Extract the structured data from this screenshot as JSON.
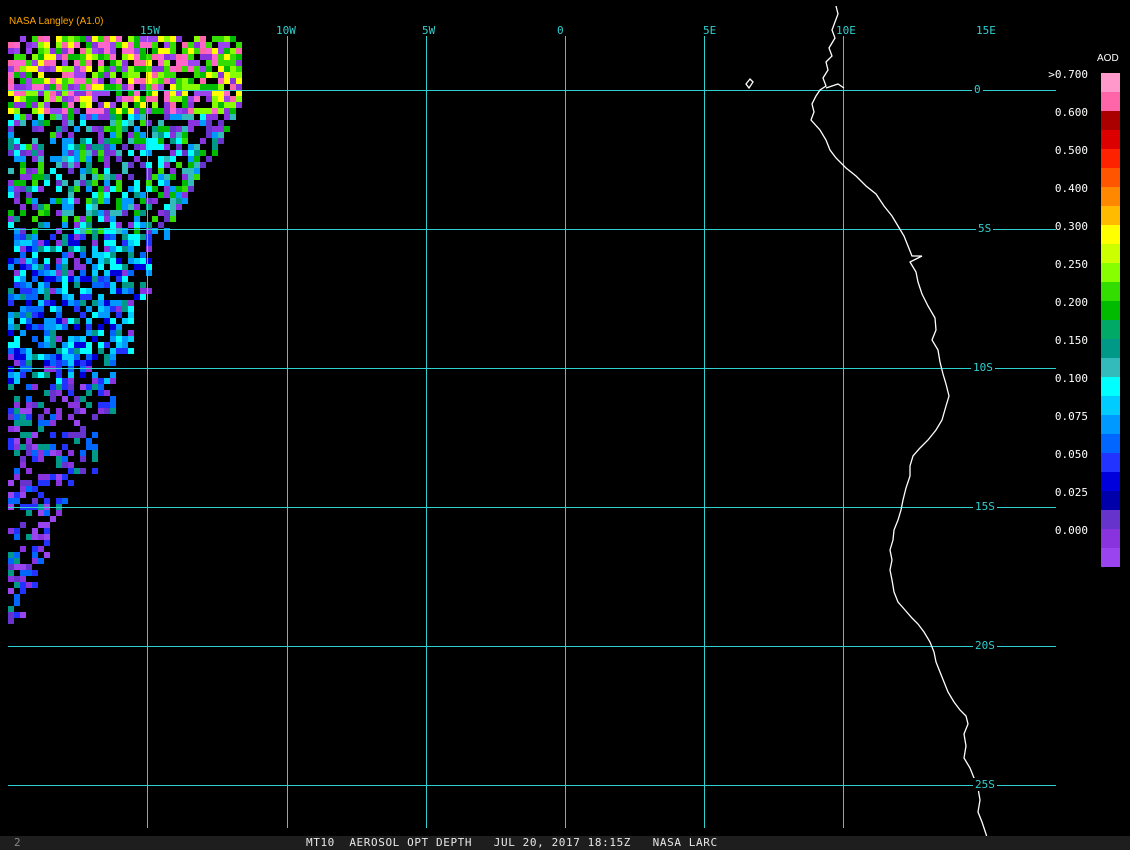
{
  "credit": "NASA Langley (A1.0)",
  "footer": {
    "text": "MT10  AEROSOL OPT DEPTH   JUL 20, 2017 18:15Z   NASA LARC",
    "page_number": "2"
  },
  "map": {
    "lon_labels": [
      "15W",
      "10W",
      "5W",
      "0",
      "5E",
      "10E",
      "15E"
    ],
    "lat_labels": [
      "0",
      "5S",
      "10S",
      "15S",
      "20S",
      "25S"
    ],
    "grid_color": "#30d0d0",
    "coastline_color": "#ffffff"
  },
  "colorbar": {
    "title": "AOD",
    "tick_labels": [
      ">0.700",
      "0.600",
      "0.500",
      "0.400",
      "0.300",
      "0.250",
      "0.200",
      "0.150",
      "0.100",
      "0.075",
      "0.050",
      "0.025",
      "0.000"
    ],
    "colors": [
      "#ff99cc",
      "#ff66aa",
      "#aa0000",
      "#dd0000",
      "#ff2200",
      "#ff5500",
      "#ff8800",
      "#ffbb00",
      "#ffff00",
      "#ccff00",
      "#88ff00",
      "#33dd00",
      "#00bb00",
      "#00aa66",
      "#009988",
      "#33bbbb",
      "#00ffff",
      "#00ccff",
      "#0099ff",
      "#0066ff",
      "#2233ff",
      "#0000dd",
      "#0000aa",
      "#6633cc",
      "#8833dd",
      "#9944ee"
    ]
  }
}
